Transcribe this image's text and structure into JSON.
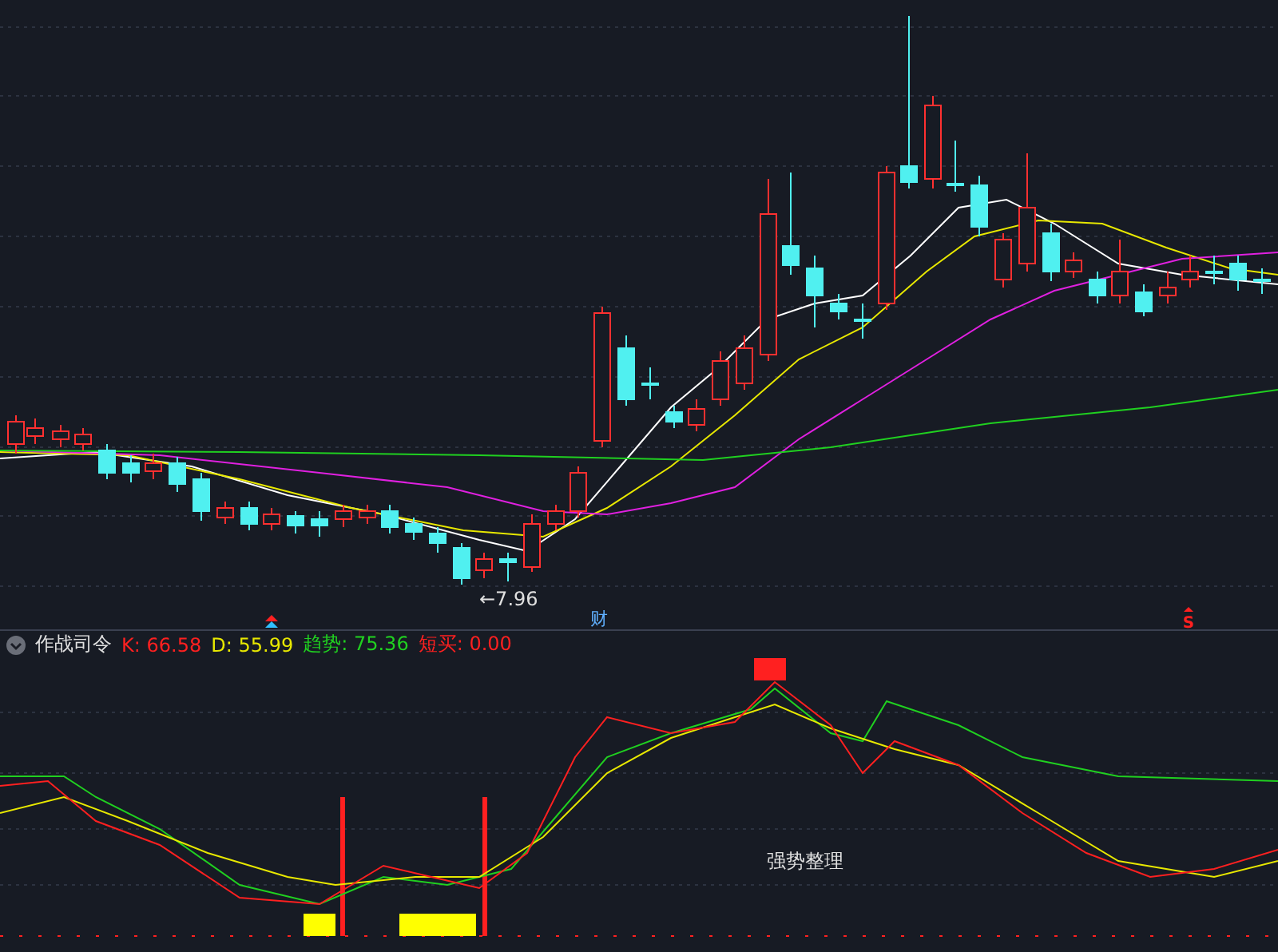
{
  "price_chart": {
    "low_label": "←7.96",
    "marks": [
      {
        "kind": "arrow"
      },
      {
        "kind": "text",
        "text": "财"
      },
      {
        "kind": "s_mark",
        "text": "S"
      }
    ]
  },
  "indicator": {
    "name": "作战司令",
    "values": [
      {
        "label": "K:",
        "value": "66.58",
        "color": "#ff2020"
      },
      {
        "label": "D:",
        "value": "55.99",
        "color": "#e8e800"
      },
      {
        "label": "趋势:",
        "value": "75.36",
        "color": "#20d020"
      },
      {
        "label": "短买:",
        "value": "0.00",
        "color": "#ff2020"
      }
    ],
    "annotation": "强势整理"
  }
}
